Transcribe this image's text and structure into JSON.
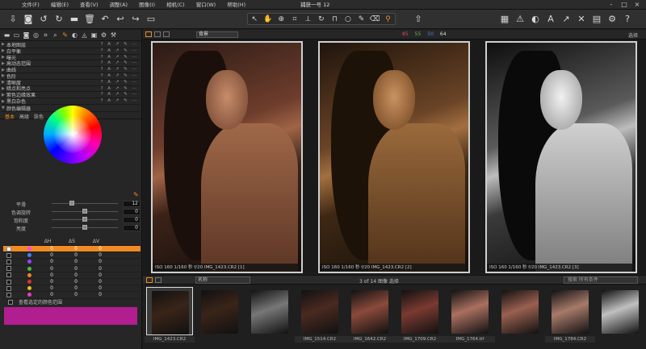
{
  "menubar": {
    "title": "捕获一号 12",
    "menus": [
      "文件(F)",
      "编辑(E)",
      "查看(V)",
      "调整(A)",
      "图像(I)",
      "相机(C)",
      "窗口(W)",
      "帮助(H)"
    ],
    "window_controls": [
      "-",
      "□",
      "×"
    ]
  },
  "toolbar": {
    "left_icons": [
      "import-icon",
      "capture-icon",
      "rotate-left-icon",
      "rotate-right-icon",
      "folder-icon",
      "delete-icon",
      "reset-icon",
      "undo-icon",
      "redo-icon",
      "variant-icon"
    ],
    "cursor_tools": [
      "select",
      "hand",
      "loupe",
      "crop",
      "straighten",
      "rotate",
      "keystone",
      "circle",
      "brush",
      "eraser",
      "picker"
    ],
    "right_icons": [
      "export-icon",
      "grid-icon",
      "warning-icon",
      "exposure-icon",
      "text-icon",
      "arrow-icon",
      "tools-icon",
      "print-icon",
      "settings-icon",
      "help-icon"
    ]
  },
  "tool_tabs": {
    "icons": [
      "folder-icon",
      "library-icon",
      "camera-icon",
      "lens-icon",
      "crop-icon",
      "search-icon",
      "color-icon",
      "exposure-icon",
      "details-icon",
      "local-icon",
      "settings-icon",
      "output-icon"
    ]
  },
  "tools": [
    {
      "label": "本地图层"
    },
    {
      "label": "白平衡"
    },
    {
      "label": "曝光"
    },
    {
      "label": "高动态范围"
    },
    {
      "label": "曲线"
    },
    {
      "label": "色阶"
    },
    {
      "label": "清晰度"
    },
    {
      "label": "暗点和亮点"
    },
    {
      "label": "紫色边缘效果"
    },
    {
      "label": "黑白杂色"
    }
  ],
  "color_editor": {
    "header": "颜色编辑器",
    "tabs": [
      "基本",
      "高级",
      "肤色"
    ]
  },
  "sliders": [
    {
      "label": "平滑",
      "value": "12",
      "pos": 0.3
    },
    {
      "label": "色调旋转",
      "value": "0",
      "pos": 0.5
    },
    {
      "label": "饱和度",
      "value": "0",
      "pos": 0.5
    },
    {
      "label": "亮度",
      "value": "0",
      "pos": 0.5
    }
  ],
  "color_table": {
    "headers": [
      "ΔH",
      "ΔS",
      "ΔV"
    ],
    "rows": [
      {
        "color": "#ff40ff",
        "h": "0",
        "s": "0",
        "v": "0",
        "sel": true
      },
      {
        "color": "#4080ff",
        "h": "0",
        "s": "0",
        "v": "0"
      },
      {
        "color": "#a040ff",
        "h": "0",
        "s": "0",
        "v": "0"
      },
      {
        "color": "#40c040",
        "h": "0",
        "s": "0",
        "v": "0"
      },
      {
        "color": "#f08020",
        "h": "0",
        "s": "0",
        "v": "0"
      },
      {
        "color": "#e03030",
        "h": "0",
        "s": "0",
        "v": "0"
      },
      {
        "color": "#e0c020",
        "h": "0",
        "s": "0",
        "v": "0"
      },
      {
        "color": "#e040c0",
        "h": "0",
        "s": "0",
        "v": "0"
      }
    ]
  },
  "checkbox_label": "查看选定的颜色范围",
  "swatch_color": "#b01e8f",
  "viewer": {
    "variant": "背景",
    "counts": [
      "85",
      "55",
      "50",
      "64"
    ],
    "right_label": "选择",
    "captions": [
      "ISO 160   1/160 秒   f/20      IMG_1423.CR2 [1]",
      "ISO 160   1/160 秒   f/20      IMG_1423.CR2 [2]",
      "ISO 160   1/160 秒   f/20      IMG_1423.CR2 [3]"
    ]
  },
  "filmbar": {
    "sort": "名称",
    "count": "3 of 14 图像 选择",
    "search": "搜索 所有条件"
  },
  "filmstrip": [
    {
      "name": "IMG_1423.CR2",
      "c": "#3a2418",
      "sel": true
    },
    {
      "name": "",
      "c": "#3a2418"
    },
    {
      "name": "",
      "c": "#777"
    },
    {
      "name": "IMG_1514.CR2",
      "c": "#4a2a20"
    },
    {
      "name": "IMG_1642.CR2",
      "c": "#8a4a3a"
    },
    {
      "name": "IMG_1709.CR2",
      "c": "#7a3a30"
    },
    {
      "name": "IMG_1764.tif",
      "c": "#aa7060"
    },
    {
      "name": "",
      "c": "#9a6050"
    },
    {
      "name": "IMG_1784.CR2",
      "c": "#a87a6a"
    },
    {
      "name": "",
      "c": "#c0c0c0"
    }
  ]
}
